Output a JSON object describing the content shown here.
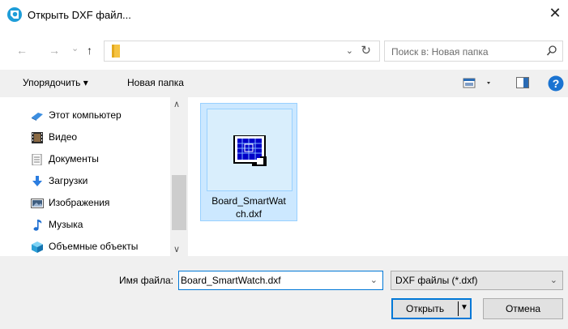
{
  "window": {
    "title": "Открыть DXF файл...",
    "close_glyph": "✕",
    "app_icon": "dxf-app-icon"
  },
  "nav": {
    "back_glyph": "←",
    "forward_glyph": "→",
    "recent_glyph": "⌄",
    "up_glyph": "↑",
    "address_dropdown_glyph": "⌄",
    "refresh_glyph": "↻",
    "search_placeholder": "Поиск в: Новая папка"
  },
  "toolbar": {
    "organize_label": "Упорядочить ▾",
    "new_folder_label": "Новая папка"
  },
  "sidebar": {
    "items": [
      {
        "label": "Этот компьютер",
        "icon": "computer-icon"
      },
      {
        "label": "Видео",
        "icon": "video-icon"
      },
      {
        "label": "Документы",
        "icon": "documents-icon"
      },
      {
        "label": "Загрузки",
        "icon": "downloads-icon"
      },
      {
        "label": "Изображения",
        "icon": "pictures-icon"
      },
      {
        "label": "Музыка",
        "icon": "music-icon"
      },
      {
        "label": "Объемные объекты",
        "icon": "3d-objects-icon"
      }
    ]
  },
  "files": [
    {
      "name": "Board_SmartWatch.dxf",
      "name_display": "Board_SmartWat ch.dxf",
      "selected": true
    }
  ],
  "footer": {
    "filename_label": "Имя файла:",
    "filename_value": "Board_SmartWatch.dxf",
    "filetype_value": "DXF файлы (*.dxf)",
    "open_label": "Открыть",
    "cancel_label": "Отмена"
  },
  "colors": {
    "selection_fill": "#cce8ff",
    "selection_border": "#99d1ff",
    "accent": "#0078d7",
    "chrome": "#f0f0f0"
  }
}
